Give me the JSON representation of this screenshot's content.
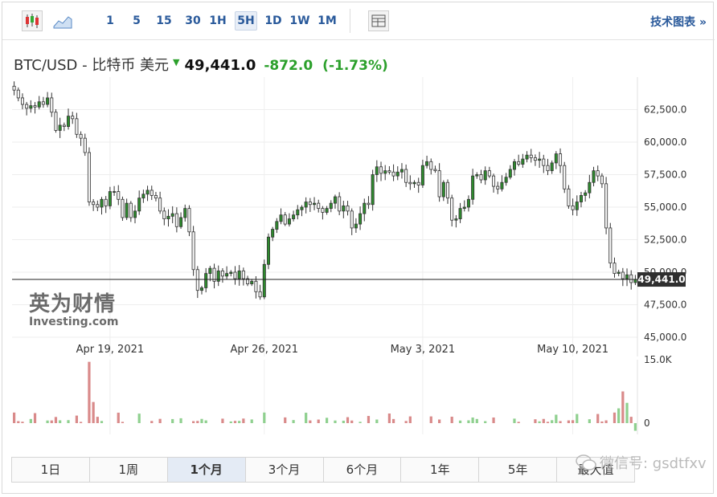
{
  "toolbar": {
    "intervals": [
      "1",
      "5",
      "15",
      "30",
      "1H",
      "5H",
      "1D",
      "1W",
      "1M"
    ],
    "active_interval": "5H",
    "tech_chart_label": "技术图表 »"
  },
  "quote": {
    "name": "BTC/USD - 比特币 美元",
    "price": "49,441.0",
    "change": "-872.0",
    "change_pct": "(-1.73%)",
    "change_color": "#2ca02c",
    "arrow_icon": "down-arrow-icon"
  },
  "logo": {
    "cn": "英为财情",
    "en": "Investing.com"
  },
  "range_tabs": [
    "1日",
    "1周",
    "1个月",
    "3个月",
    "6个月",
    "1年",
    "5年",
    "最大值"
  ],
  "active_range": "1个月",
  "watermark": "微信号: gsdtfxv",
  "colors": {
    "up": "#2e8b2e",
    "down": "#f4f4f4",
    "volume_up": "#8fd08f",
    "volume_down": "#d98a8a",
    "link": "#2a5a9b"
  },
  "chart_data": {
    "type": "candlestick",
    "ylim": [
      45000,
      65000
    ],
    "y_ticks": [
      {
        "v": 62500,
        "label": "62,500.0"
      },
      {
        "v": 60000,
        "label": "60,000.0"
      },
      {
        "v": 57500,
        "label": "57,500.0"
      },
      {
        "v": 55000,
        "label": "55,000.0"
      },
      {
        "v": 52500,
        "label": "52,500.0"
      },
      {
        "v": 50000,
        "label": "50,000.0"
      },
      {
        "v": 47500,
        "label": "47,500.0"
      },
      {
        "v": 45000,
        "label": "45,000.0"
      }
    ],
    "x_ticks": [
      {
        "i": 23,
        "label": "Apr 19, 2021"
      },
      {
        "i": 60,
        "label": "Apr 26, 2021"
      },
      {
        "i": 98,
        "label": "May 3, 2021"
      },
      {
        "i": 134,
        "label": "May 10, 2021"
      }
    ],
    "current_price": 49441,
    "current_label": "49,441.0",
    "volume_ticks": [
      {
        "v": 15000,
        "label": "15.0K"
      },
      {
        "v": 0,
        "label": "0"
      }
    ],
    "volume_max": 15000,
    "closes": [
      64000,
      63400,
      62900,
      62600,
      62800,
      62700,
      63100,
      62900,
      63400,
      62300,
      60900,
      61300,
      61200,
      62000,
      61800,
      60600,
      60300,
      59200,
      55400,
      55200,
      55000,
      55600,
      55100,
      56200,
      56200,
      55600,
      54200,
      55300,
      54200,
      54700,
      55700,
      56000,
      56300,
      55900,
      55700,
      54700,
      54100,
      54300,
      54500,
      53500,
      54200,
      54900,
      53100,
      50200,
      48600,
      48800,
      49900,
      50300,
      49300,
      50100,
      49700,
      49900,
      50000,
      49500,
      50100,
      49500,
      49100,
      49300,
      48500,
      48100,
      50600,
      52700,
      53300,
      53900,
      54400,
      53700,
      54100,
      54400,
      54800,
      55000,
      55400,
      55200,
      55300,
      54900,
      54600,
      54900,
      55300,
      55800,
      54700,
      55100,
      54700,
      53400,
      53700,
      54500,
      55300,
      55200,
      57500,
      58100,
      57600,
      57800,
      57700,
      57400,
      57700,
      57900,
      56900,
      56800,
      56900,
      56700,
      58200,
      58500,
      57900,
      57800,
      55800,
      56900,
      55700,
      54000,
      54100,
      54900,
      55000,
      55600,
      57400,
      57500,
      57100,
      57800,
      57400,
      56600,
      56400,
      56900,
      57300,
      57900,
      58500,
      58300,
      58700,
      59000,
      58800,
      58600,
      58700,
      58200,
      57800,
      58400,
      59100,
      58200,
      56400,
      55100,
      54800,
      55400,
      55900,
      56100,
      56900,
      57800,
      57400,
      56800,
      53400,
      50700,
      49900,
      50000,
      49500,
      49800,
      49200,
      49441
    ]
  }
}
